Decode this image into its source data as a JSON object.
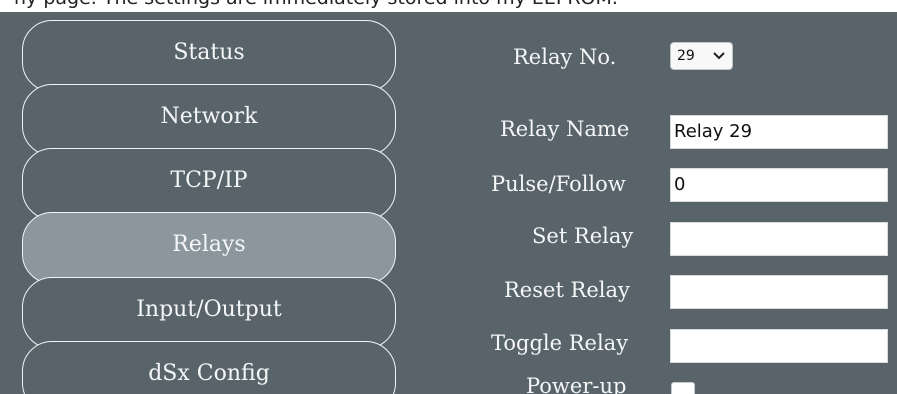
{
  "page_top": {
    "partial_text": "ny page. The settings are immediately stored into my EEPROM."
  },
  "sidebar": {
    "items": [
      {
        "label": "Status"
      },
      {
        "label": "Network"
      },
      {
        "label": "TCP/IP"
      },
      {
        "label": "Relays"
      },
      {
        "label": "Input/Output"
      },
      {
        "label": "dSx Config"
      }
    ],
    "active": "Relays"
  },
  "form": {
    "relay_no_label": "Relay No.",
    "relay_no_value": "29",
    "relay_name_label": "Relay Name",
    "relay_name_value": "Relay 29",
    "pulse_follow_label": "Pulse/Follow",
    "pulse_follow_value": "0",
    "set_relay_label": "Set Relay",
    "set_relay_value": "",
    "reset_relay_label": "Reset Relay",
    "reset_relay_value": "",
    "toggle_relay_label": "Toggle Relay",
    "toggle_relay_value": "",
    "power_up_label": "Power-up",
    "power_up_checked": false
  },
  "colors": {
    "panel_background": "#58646a",
    "active_item_background": "#8b979c",
    "border_and_text": "#f4f6f7"
  },
  "icons": {
    "relay_select": "chevron-down-icon"
  }
}
